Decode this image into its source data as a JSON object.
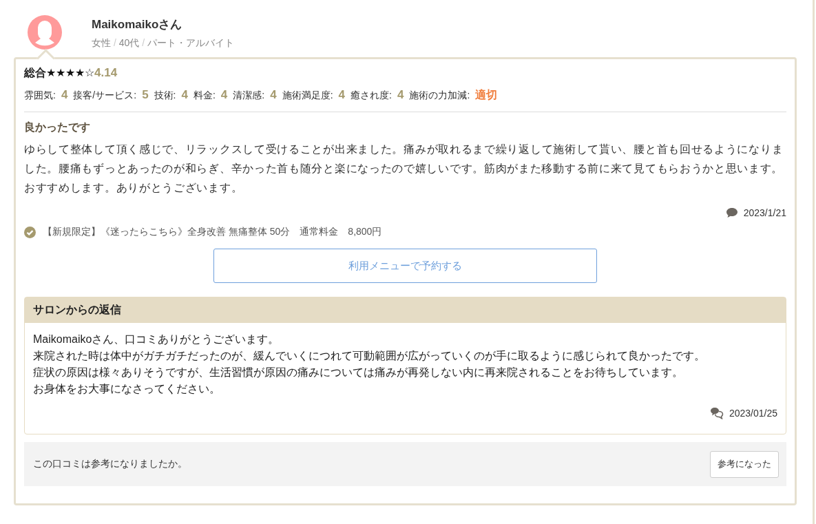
{
  "reviewer": {
    "name": "Maikomaikoさん",
    "gender": "女性",
    "age": "40代",
    "occupation": "パート・アルバイト",
    "separator": "/"
  },
  "overall": {
    "label": "総合",
    "stars": 4,
    "score": "4.14"
  },
  "ratings": [
    {
      "label": "雰囲気:",
      "value": "4",
      "kind": "score"
    },
    {
      "label": "接客/サービス:",
      "value": "5",
      "kind": "score"
    },
    {
      "label": "技術:",
      "value": "4",
      "kind": "score"
    },
    {
      "label": "料金:",
      "value": "4",
      "kind": "score"
    },
    {
      "label": "清潔感:",
      "value": "4",
      "kind": "score"
    },
    {
      "label": "施術満足度:",
      "value": "4",
      "kind": "score"
    },
    {
      "label": "癒され度:",
      "value": "4",
      "kind": "score"
    },
    {
      "label": "施術の力加減:",
      "value": "適切",
      "kind": "word"
    }
  ],
  "review": {
    "title": "良かったです",
    "body": "ゆらして整体して頂く感じで、リラックスして受けることが出来ました。痛みが取れるまで繰り返して施術して貰い、腰と首も回せるようになりました。腰痛もずっとあったのが和らぎ、辛かった首も随分と楽になったので嬉しいです。筋肉がまた移動する前に来て見てもらおうかと思います。おすすめします。ありがとうございます。",
    "date": "2023/1/21"
  },
  "menu": {
    "text": "【新規限定】《迷ったらこちら》全身改善 無痛整体 50分　通常料金　8,800円",
    "button": "利用メニューで予約する"
  },
  "reply": {
    "title": "サロンからの返信",
    "lines": [
      "Maikomaikoさん、口コミありがとうございます。",
      "来院された時は体中がガチガチだったのが、緩んでいくにつれて可動範囲が広がっていくのが手に取るように感じられて良かったです。",
      "症状の原因は様々ありそうですが、生活習慣が原因の痛みについては痛みが再発しない内に再来院されることをお待ちしています。",
      "お身体をお大事になさってください。"
    ],
    "date": "2023/01/25"
  },
  "helpful": {
    "question": "この口コミは参考になりましたか。",
    "button": "参考になった"
  }
}
